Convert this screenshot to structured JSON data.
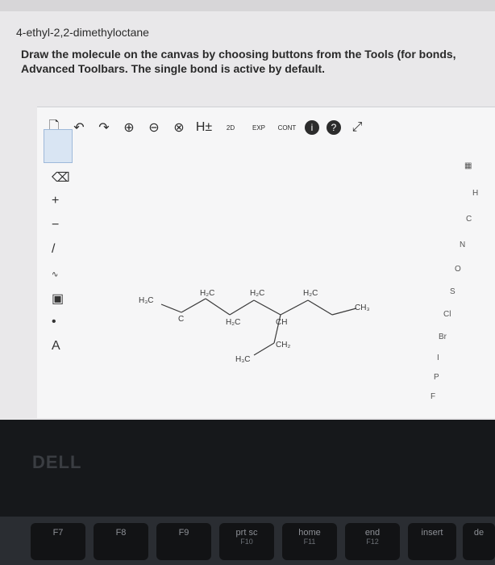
{
  "page": {
    "title": "4-ethyl-2,2-dimethyloctane",
    "instructions_line1": "Draw the molecule on the canvas by choosing buttons from the Tools (for bonds,",
    "instructions_line2": "Advanced Toolbars. The single bond is active by default."
  },
  "toolbar": {
    "items": [
      {
        "icon": "new-doc-icon",
        "glyph": "🗋"
      },
      {
        "icon": "undo-icon",
        "glyph": "↶"
      },
      {
        "icon": "redo-icon",
        "glyph": "↷"
      },
      {
        "icon": "zoom-in-icon",
        "glyph": "⊕"
      },
      {
        "icon": "zoom-out-icon",
        "glyph": "⊖"
      },
      {
        "icon": "clear-icon",
        "glyph": "⊗"
      },
      {
        "icon": "hydrogen-icon",
        "glyph": "H±"
      },
      {
        "icon": "2d-clean-icon",
        "glyph": "2D"
      },
      {
        "icon": "exp-icon",
        "glyph": "EXP"
      },
      {
        "icon": "cont-icon",
        "glyph": "CONT"
      },
      {
        "icon": "info-icon",
        "glyph": "i"
      },
      {
        "icon": "help-icon",
        "glyph": "?"
      },
      {
        "icon": "expand-icon",
        "glyph": "⤢"
      }
    ]
  },
  "left_tools": {
    "labels": [
      "+",
      "−",
      "A"
    ]
  },
  "right_tools": {
    "elements": [
      "H",
      "C",
      "N",
      "O",
      "S",
      "Cl",
      "Br",
      "I",
      "P",
      "F"
    ]
  },
  "molecule": {
    "labels": {
      "h3c_left": "H₃C",
      "c_quat": "C",
      "ch2_a": "H₂C",
      "ch_b": "CH",
      "ch2_c": "H₂C",
      "ch2_d": "H₂C",
      "ch2_e": "H₂C",
      "ch3_right": "CH₃",
      "ch2_ethyl": "CH₂",
      "h3c_ethyl": "H₃C"
    }
  },
  "laptop": {
    "brand": "DELL",
    "keys": [
      {
        "main": "F7",
        "sub": ""
      },
      {
        "main": "F8",
        "sub": ""
      },
      {
        "main": "F9",
        "sub": ""
      },
      {
        "main": "prt sc",
        "sub": "F10"
      },
      {
        "main": "home",
        "sub": "F11"
      },
      {
        "main": "end",
        "sub": "F12"
      },
      {
        "main": "insert",
        "sub": ""
      },
      {
        "main": "de",
        "sub": ""
      }
    ]
  }
}
